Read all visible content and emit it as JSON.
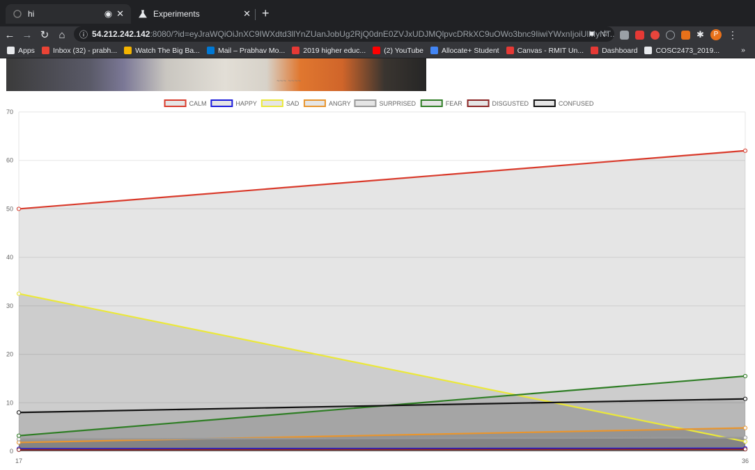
{
  "browser": {
    "tabs": [
      {
        "title": "hi",
        "active": false
      },
      {
        "title": "Experiments",
        "active": true
      }
    ],
    "address": {
      "host": "54.212.242.142",
      "rest": ":8080/?id=eyJraWQiOiJnXC9IWXdtd3llYnZUanJobUg2RjQ0dnE0ZVJxUDJMQlpvcDRkXC9uOWo3bnc9IiwiYWxnIjoiUlMyNT..."
    },
    "profile_initial": "P",
    "bookmarks": [
      {
        "label": "Apps",
        "color": "#e8eaed"
      },
      {
        "label": "Inbox (32) - prabh...",
        "color": "#ea4335"
      },
      {
        "label": "Watch The Big Ba...",
        "color": "#f4b400"
      },
      {
        "label": "Mail – Prabhav Mo...",
        "color": "#0078d4"
      },
      {
        "label": "2019 higher educ...",
        "color": "#e53935"
      },
      {
        "label": "(2) YouTube",
        "color": "#ff0000"
      },
      {
        "label": "Allocate+ Student",
        "color": "#4285f4"
      },
      {
        "label": "Canvas - RMIT Un...",
        "color": "#e53935"
      },
      {
        "label": "Dashboard",
        "color": "#e53935"
      },
      {
        "label": "COSC2473_2019...",
        "color": "#e8eaed"
      }
    ],
    "bookmarks_more": "»"
  },
  "chart_data": {
    "type": "line",
    "fill": true,
    "x": [
      17,
      36
    ],
    "ylim": [
      0,
      70
    ],
    "yticks": [
      0,
      10,
      20,
      30,
      40,
      50,
      60,
      70
    ],
    "legend_position": "top",
    "grid": true,
    "series": [
      {
        "name": "CALM",
        "color": "#d93a2b",
        "values": [
          50,
          62
        ]
      },
      {
        "name": "HAPPY",
        "color": "#1a1adb",
        "values": [
          0.5,
          0.6
        ]
      },
      {
        "name": "SAD",
        "color": "#ebe83a",
        "values": [
          32.5,
          2
        ]
      },
      {
        "name": "ANGRY",
        "color": "#e8952e",
        "values": [
          1.8,
          4.8
        ]
      },
      {
        "name": "SURPRISED",
        "color": "#999999",
        "values": [
          2.5,
          2.8
        ]
      },
      {
        "name": "FEAR",
        "color": "#2e7d24",
        "values": [
          3.2,
          15.5
        ]
      },
      {
        "name": "DISGUSTED",
        "color": "#8b2525",
        "values": [
          0.3,
          0.4
        ]
      },
      {
        "name": "CONFUSED",
        "color": "#111111",
        "values": [
          8,
          10.8
        ]
      }
    ]
  }
}
